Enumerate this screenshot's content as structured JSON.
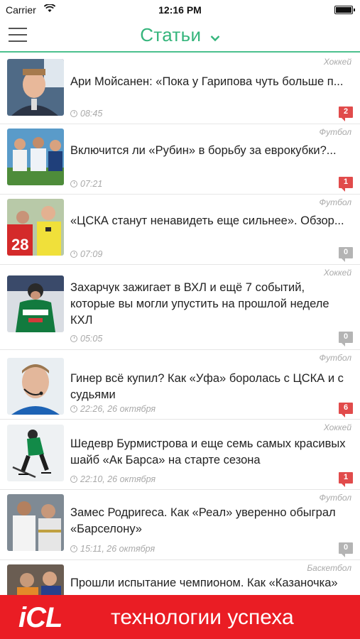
{
  "status_bar": {
    "carrier": "Carrier",
    "time": "12:16 PM"
  },
  "nav": {
    "title": "Статьи"
  },
  "articles": [
    {
      "category": "Хоккей",
      "title": "Ари Мойсанен: «Пока у Гарипова чуть больше п...",
      "time": "08:45",
      "comments": "2",
      "thumb": "portrait-coach-icon"
    },
    {
      "category": "Футбол",
      "title": "Включится ли «Рубин» в борьбу за еврокубки?...",
      "time": "07:21",
      "comments": "1",
      "thumb": "football-team-icon"
    },
    {
      "category": "Футбол",
      "title": "«ЦСКА станут ненавидеть еще сильнее». Обзор...",
      "time": "07:09",
      "comments": "0",
      "thumb": "referee-icon"
    },
    {
      "category": "Хоккей",
      "title": "Захарчук зажигает в ВХЛ и ещё 7 событий, которые вы могли упустить на прошлой неделе КХЛ",
      "time": "05:05",
      "comments": "0",
      "thumb": "hockey-player-icon"
    },
    {
      "category": "Футбол",
      "title": "Гинер всё купил? Как «Уфа» боролась с ЦСКА и с судьями",
      "time": "22:26, 26 октября",
      "comments": "6",
      "thumb": "referee-headset-icon"
    },
    {
      "category": "Хоккей",
      "title": "Шедевр Бурмистрова и еще семь самых красивых шайб «Ак Барса» на старте сезона",
      "time": "22:10, 26 октября",
      "comments": "1",
      "thumb": "hockey-skater-icon"
    },
    {
      "category": "Футбол",
      "title": "Замес Родригеса. Как «Реал» уверенно обыграл «Барселону»",
      "time": "15:11, 26 октября",
      "comments": "0",
      "thumb": "football-players-icon"
    },
    {
      "category": "Баскетбол",
      "title": "Прошли испытание чемпионом. Как «Казаночка»",
      "time": "",
      "comments": "",
      "thumb": "basketball-icon"
    }
  ],
  "banner": {
    "logo": "iCL",
    "slogan": "технологии успеха"
  },
  "colors": {
    "accent": "#35b57c",
    "badge_hot": "#e14b4b",
    "badge_zero": "#b4b4b4",
    "banner_bg": "#ea1d24"
  }
}
